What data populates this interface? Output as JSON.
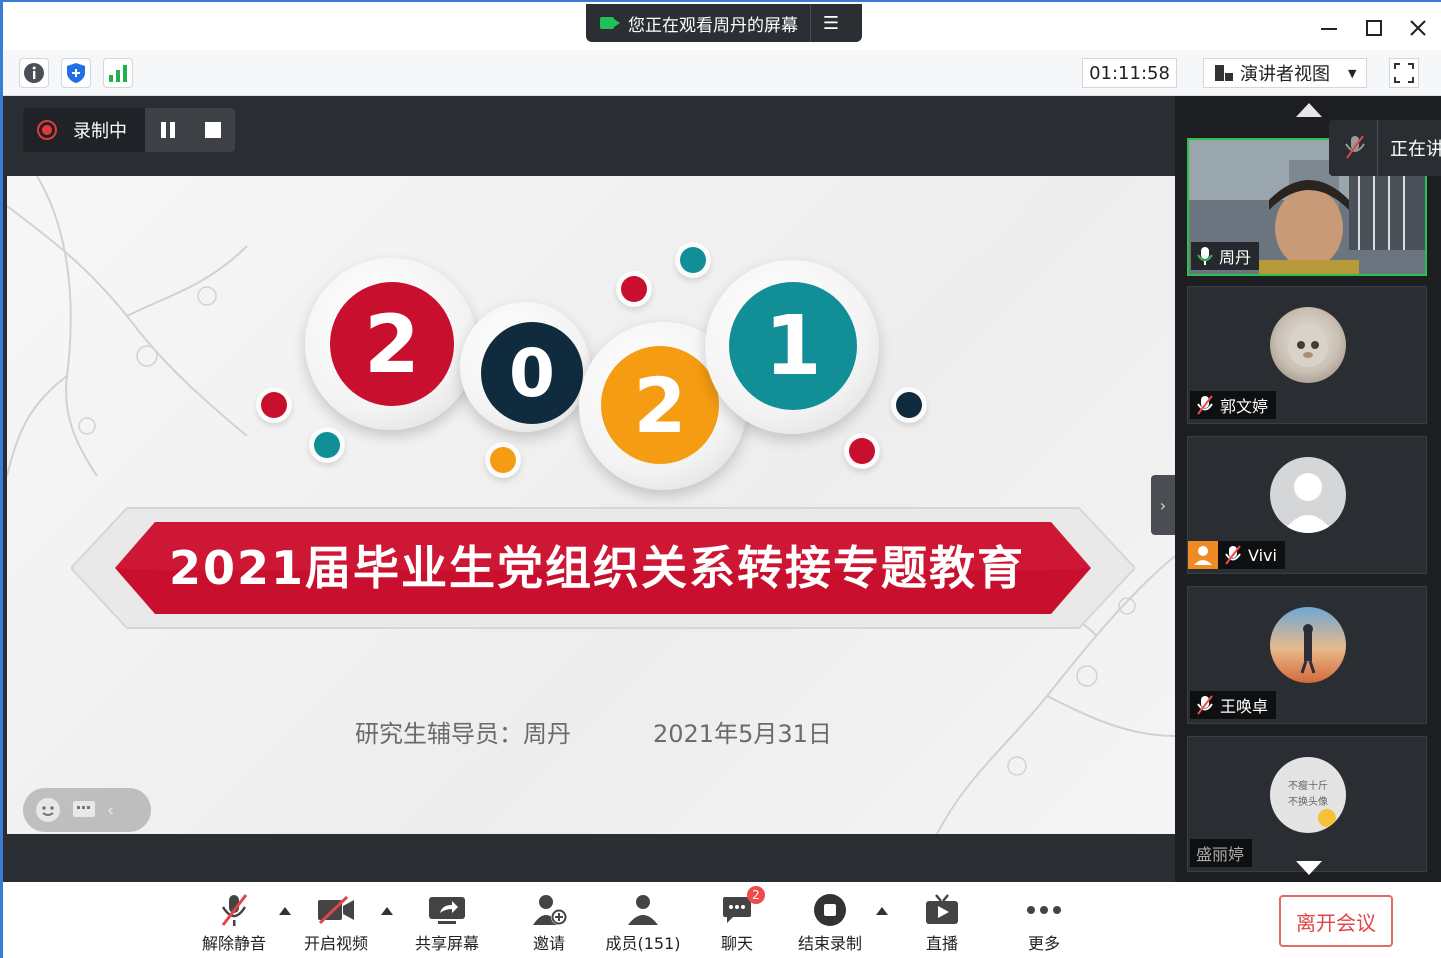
{
  "titlebar": {
    "share_banner": "您正在观看周丹的屏幕"
  },
  "infobar": {
    "timer": "01:11:58",
    "view_mode": "演讲者视图"
  },
  "recording": {
    "label": "录制中"
  },
  "slide": {
    "digits": [
      "2",
      "0",
      "2",
      "1"
    ],
    "title": "2021届毕业生党组织关系转接专题教育",
    "presenter": "研究生辅导员：周丹",
    "date": "2021年5月31日"
  },
  "participants": {
    "speaking_label": "正在讲",
    "list": [
      {
        "name": "周丹"
      },
      {
        "name": "郭文婷"
      },
      {
        "name": "Vivi"
      },
      {
        "name": "王唤卓"
      },
      {
        "name": "盛丽婷",
        "avatar_text": [
          "不瘦十斤",
          "不换头像"
        ]
      }
    ]
  },
  "bottombar": {
    "unmute": "解除静音",
    "start_video": "开启视频",
    "share_screen": "共享屏幕",
    "invite": "邀请",
    "members": "成员(151)",
    "chat": "聊天",
    "chat_badge": "2",
    "stop_recording": "结束录制",
    "live": "直播",
    "more": "更多",
    "leave": "离开会议"
  },
  "colors": {
    "accent_red": "#c8102e",
    "teal": "#128e96",
    "navy": "#0f2b3d",
    "orange": "#f59c12",
    "recording_red": "#e4393c",
    "leave_red": "#e04646"
  }
}
